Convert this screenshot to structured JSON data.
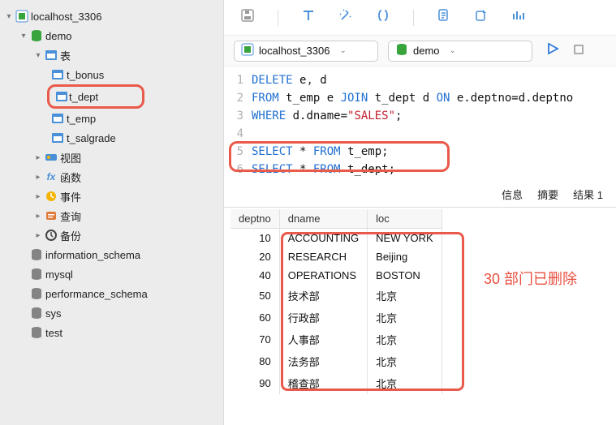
{
  "sidebar": {
    "connection": "localhost_3306",
    "database": "demo",
    "tables_label": "表",
    "tables": [
      {
        "name": "t_bonus"
      },
      {
        "name": "t_dept",
        "selected": true
      },
      {
        "name": "t_emp"
      },
      {
        "name": "t_salgrade"
      }
    ],
    "views": "视图",
    "functions": "函数",
    "events": "事件",
    "queries": "查询",
    "backup": "备份",
    "other_dbs": [
      "information_schema",
      "mysql",
      "performance_schema",
      "sys",
      "test"
    ]
  },
  "connection_bar": {
    "connection": "localhost_3306",
    "database": "demo"
  },
  "editor": {
    "lines": [
      {
        "n": "1",
        "tokens": [
          [
            "kw",
            "DELETE"
          ],
          [
            "",
            " e"
          ],
          [
            "comma",
            ","
          ],
          [
            "",
            " d"
          ]
        ]
      },
      {
        "n": "2",
        "tokens": [
          [
            "kw",
            "FROM"
          ],
          [
            "",
            " t_emp e "
          ],
          [
            "kw",
            "JOIN"
          ],
          [
            "",
            " t_dept d "
          ],
          [
            "kw",
            "ON"
          ],
          [
            "",
            " e.deptno=d.deptno"
          ]
        ]
      },
      {
        "n": "3",
        "tokens": [
          [
            "kw",
            "WHERE"
          ],
          [
            "",
            " d.dname="
          ],
          [
            "str",
            "\"SALES\""
          ],
          [
            "",
            ";"
          ]
        ]
      },
      {
        "n": "4",
        "tokens": [
          [
            "",
            ""
          ]
        ]
      },
      {
        "n": "5",
        "tokens": [
          [
            "kw",
            "SELECT"
          ],
          [
            "",
            " * "
          ],
          [
            "kw",
            "FROM"
          ],
          [
            "",
            " t_emp;"
          ]
        ]
      },
      {
        "n": "6",
        "tokens": [
          [
            "kw",
            "SELECT"
          ],
          [
            "",
            " * "
          ],
          [
            "kw",
            "FROM"
          ],
          [
            "",
            " t_dept;"
          ]
        ]
      }
    ]
  },
  "tabs": {
    "info": "信息",
    "summary": "摘要",
    "result": "结果 1"
  },
  "results": {
    "columns": [
      "deptno",
      "dname",
      "loc"
    ],
    "rows": [
      [
        "10",
        "ACCOUNTING",
        "NEW YORK"
      ],
      [
        "20",
        "RESEARCH",
        "Beijing"
      ],
      [
        "40",
        "OPERATIONS",
        "BOSTON"
      ],
      [
        "50",
        "技术部",
        "北京"
      ],
      [
        "60",
        "行政部",
        "北京"
      ],
      [
        "70",
        "人事部",
        "北京"
      ],
      [
        "80",
        "法务部",
        "北京"
      ],
      [
        "90",
        "稽查部",
        "北京"
      ]
    ]
  },
  "annotation": "30 部门已删除",
  "chart_data": {
    "type": "table",
    "title": "t_dept",
    "columns": [
      "deptno",
      "dname",
      "loc"
    ],
    "rows": [
      [
        10,
        "ACCOUNTING",
        "NEW YORK"
      ],
      [
        20,
        "RESEARCH",
        "Beijing"
      ],
      [
        40,
        "OPERATIONS",
        "BOSTON"
      ],
      [
        50,
        "技术部",
        "北京"
      ],
      [
        60,
        "行政部",
        "北京"
      ],
      [
        70,
        "人事部",
        "北京"
      ],
      [
        80,
        "法务部",
        "北京"
      ],
      [
        90,
        "稽查部",
        "北京"
      ]
    ]
  }
}
